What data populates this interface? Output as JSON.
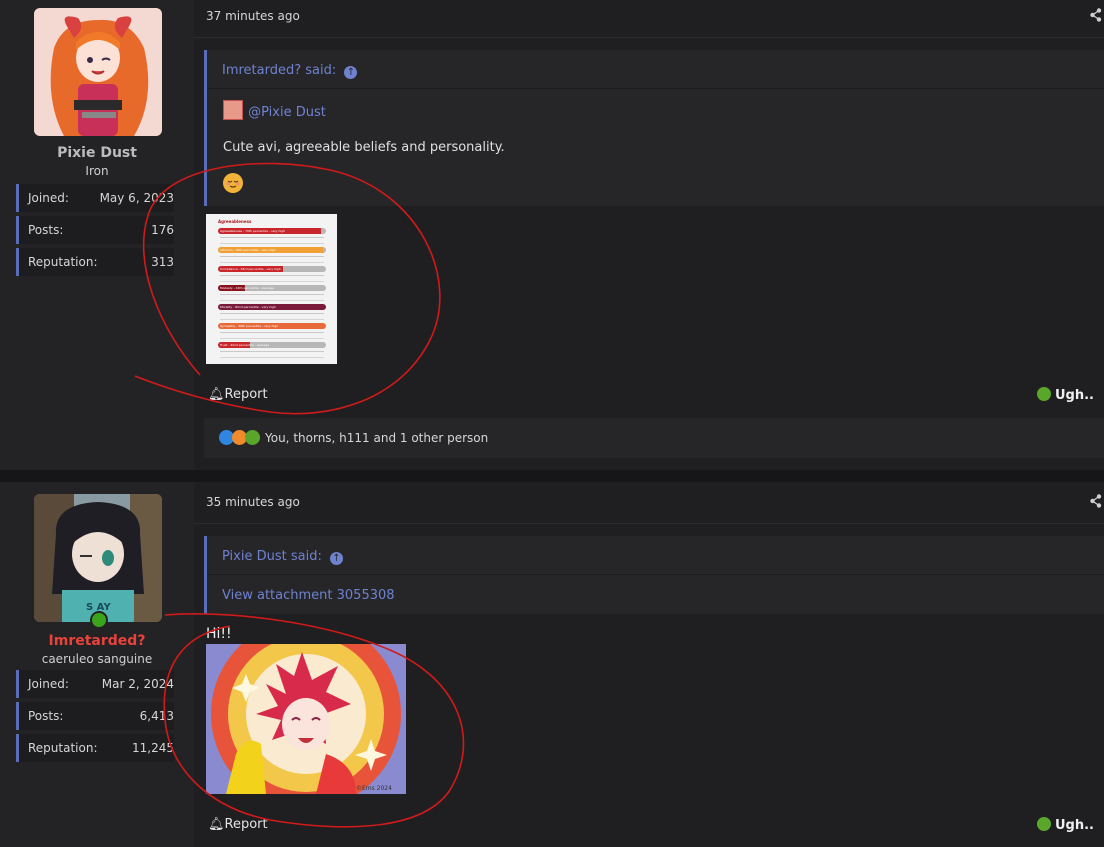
{
  "posts": [
    {
      "user": {
        "name": "Pixie Dust",
        "name_color": "#bcbcbc",
        "title": "Iron"
      },
      "stats": [
        {
          "label": "Joined:",
          "value": "May 6, 2023"
        },
        {
          "label": "Posts:",
          "value": "176"
        },
        {
          "label": "Reputation:",
          "value": "313"
        }
      ],
      "time": "37 minutes ago",
      "quote": {
        "author": "Imretarded? said:",
        "mention": "@Pixie Dust",
        "text": "Cute avi, agreeable beliefs and personality."
      },
      "attachment": {
        "title": "Agreeableness",
        "rows": [
          {
            "label": "Agreeableness - 70th percentile - very high",
            "color": "#c8262b",
            "fill": 0.95
          },
          {
            "label": "Altruism - 76th percentile - very high",
            "color": "#f0a035",
            "fill": 0.97
          },
          {
            "label": "Compliance - 63rd percentile - very high",
            "color": "#c8262b",
            "fill": 0.6
          },
          {
            "label": "Modesty - 44th percentile - average",
            "color": "#8a1020",
            "fill": 0.25
          },
          {
            "label": "Morality - 82nd percentile - very high",
            "color": "#7a1a3a",
            "fill": 1.0
          },
          {
            "label": "Sympathy - 46th percentile - very high",
            "color": "#e86a3a",
            "fill": 1.0
          },
          {
            "label": "Trust - 42nd percentile - average",
            "color": "#c8262b",
            "fill": 0.3
          }
        ]
      },
      "report_label": "Report",
      "reaction_label": "Ugh..",
      "reactions_text": "You, thorns, h111 and 1 other person"
    },
    {
      "user": {
        "name": "Imretarded?",
        "name_color": "#e8433b",
        "title": "caeruleo sanguine"
      },
      "stats": [
        {
          "label": "Joined:",
          "value": "Mar 2, 2024"
        },
        {
          "label": "Posts:",
          "value": "6,413"
        },
        {
          "label": "Reputation:",
          "value": "11,245"
        }
      ],
      "time": "35 minutes ago",
      "quote": {
        "author": "Pixie Dust said:",
        "link": "View attachment 3055308"
      },
      "body_text": "Hi!!",
      "image_signature": "©Ems 2024",
      "report_label": "Report",
      "reaction_label": "Ugh.."
    }
  ],
  "colors": {
    "accent": "#5a6db8",
    "link": "#6f82cf",
    "annotation": "#d11a1a"
  }
}
